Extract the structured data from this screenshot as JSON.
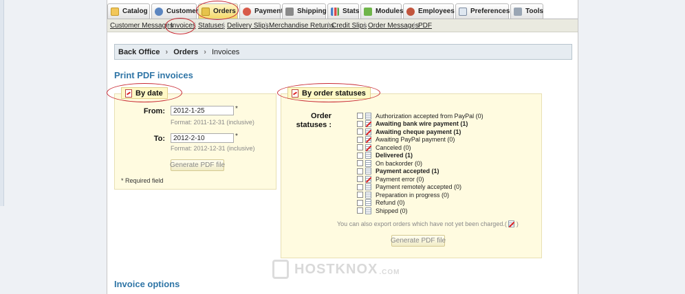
{
  "tabs": [
    {
      "label": "Catalog",
      "icon": "folder-icon"
    },
    {
      "label": "Customers",
      "icon": "user-icon"
    },
    {
      "label": "Orders",
      "icon": "cart-icon"
    },
    {
      "label": "Payment",
      "icon": "payment-icon"
    },
    {
      "label": "Shipping",
      "icon": "truck-icon"
    },
    {
      "label": "Stats",
      "icon": "chart-icon"
    },
    {
      "label": "Modules",
      "icon": "puzzle-icon"
    },
    {
      "label": "Employees",
      "icon": "employee-icon"
    },
    {
      "label": "Preferences",
      "icon": "preferences-icon"
    },
    {
      "label": "Tools",
      "icon": "wrench-icon"
    }
  ],
  "active_tab": "Orders",
  "subnav": [
    "Customer Messages",
    "Invoices",
    "Statuses",
    "Delivery Slips",
    "Merchandise Returns",
    "Credit Slips",
    "Order Messages",
    "PDF"
  ],
  "breadcrumb": {
    "root": "Back Office",
    "section": "Orders",
    "current": "Invoices"
  },
  "page_title": "Print PDF invoices",
  "by_date": {
    "legend": "By date",
    "from_label": "From:",
    "from_value": "2012-1-25",
    "from_hint": "Format: 2011-12-31 (inclusive)",
    "to_label": "To:",
    "to_value": "2012-2-10",
    "to_hint": "Format: 2012-12-31 (inclusive)",
    "required_mark": "*",
    "button": "Generate PDF file",
    "required_note": "* Required field"
  },
  "by_status": {
    "legend": "By order statuses",
    "label": "Order\nstatuses :",
    "label_line1": "Order",
    "label_line2": "statuses :",
    "statuses": [
      {
        "text": "Authorization accepted from PayPal (0)",
        "bold": false,
        "crossed": false
      },
      {
        "text": "Awaiting bank wire payment (1)",
        "bold": true,
        "crossed": true
      },
      {
        "text": "Awaiting cheque payment (1)",
        "bold": true,
        "crossed": true
      },
      {
        "text": "Awaiting PayPal payment (0)",
        "bold": false,
        "crossed": true
      },
      {
        "text": "Canceled (0)",
        "bold": false,
        "crossed": true
      },
      {
        "text": "Delivered (1)",
        "bold": true,
        "crossed": false
      },
      {
        "text": "On backorder (0)",
        "bold": false,
        "crossed": false
      },
      {
        "text": "Payment accepted (1)",
        "bold": true,
        "crossed": false
      },
      {
        "text": "Payment error (0)",
        "bold": false,
        "crossed": true
      },
      {
        "text": "Payment remotely accepted (0)",
        "bold": false,
        "crossed": false
      },
      {
        "text": "Preparation in progress (0)",
        "bold": false,
        "crossed": false
      },
      {
        "text": "Refund (0)",
        "bold": false,
        "crossed": false
      },
      {
        "text": "Shipped (0)",
        "bold": false,
        "crossed": false
      }
    ],
    "note_before": "You can also export orders which have not yet been charged.(",
    "note_after": " )",
    "button": "Generate PDF file"
  },
  "invoice_options_title": "Invoice options",
  "watermark": {
    "text": "HOSTKNOX",
    "suffix": ".COM"
  },
  "colors": {
    "heading": "#2f75a6",
    "annotation": "#c8262f",
    "fieldset_bg": "#fffbe0"
  }
}
